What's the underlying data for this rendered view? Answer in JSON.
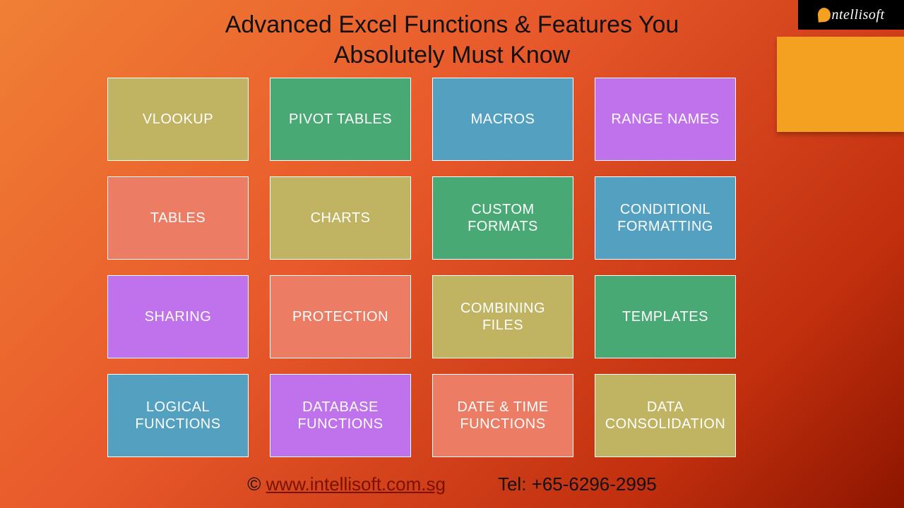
{
  "title": "Advanced Excel Functions & Features You\nAbsolutely Must Know",
  "logo_text": "ntellisoft",
  "tiles": [
    {
      "label": "VLOOKUP",
      "color": "c-olive"
    },
    {
      "label": "PIVOT TABLES",
      "color": "c-green"
    },
    {
      "label": "MACROS",
      "color": "c-blue"
    },
    {
      "label": "RANGE NAMES",
      "color": "c-purple"
    },
    {
      "label": "TABLES",
      "color": "c-coral"
    },
    {
      "label": "CHARTS",
      "color": "c-olive"
    },
    {
      "label": "CUSTOM\nFORMATS",
      "color": "c-green"
    },
    {
      "label": "CONDITIONL\nFORMATTING",
      "color": "c-blue"
    },
    {
      "label": "SHARING",
      "color": "c-purple"
    },
    {
      "label": "PROTECTION",
      "color": "c-coral"
    },
    {
      "label": "COMBINING\nFILES",
      "color": "c-olive"
    },
    {
      "label": "TEMPLATES",
      "color": "c-green"
    },
    {
      "label": "LOGICAL\nFUNCTIONS",
      "color": "c-blue"
    },
    {
      "label": "DATABASE\nFUNCTIONS",
      "color": "c-purple"
    },
    {
      "label": "DATE & TIME\nFUNCTIONS",
      "color": "c-coral"
    },
    {
      "label": "DATA\nCONSOLIDATION",
      "color": "c-olive"
    }
  ],
  "footer": {
    "copyright": "© ",
    "link_text": "www.intellisoft.com.sg",
    "tel_label": "Tel: +65-6296-2995"
  }
}
